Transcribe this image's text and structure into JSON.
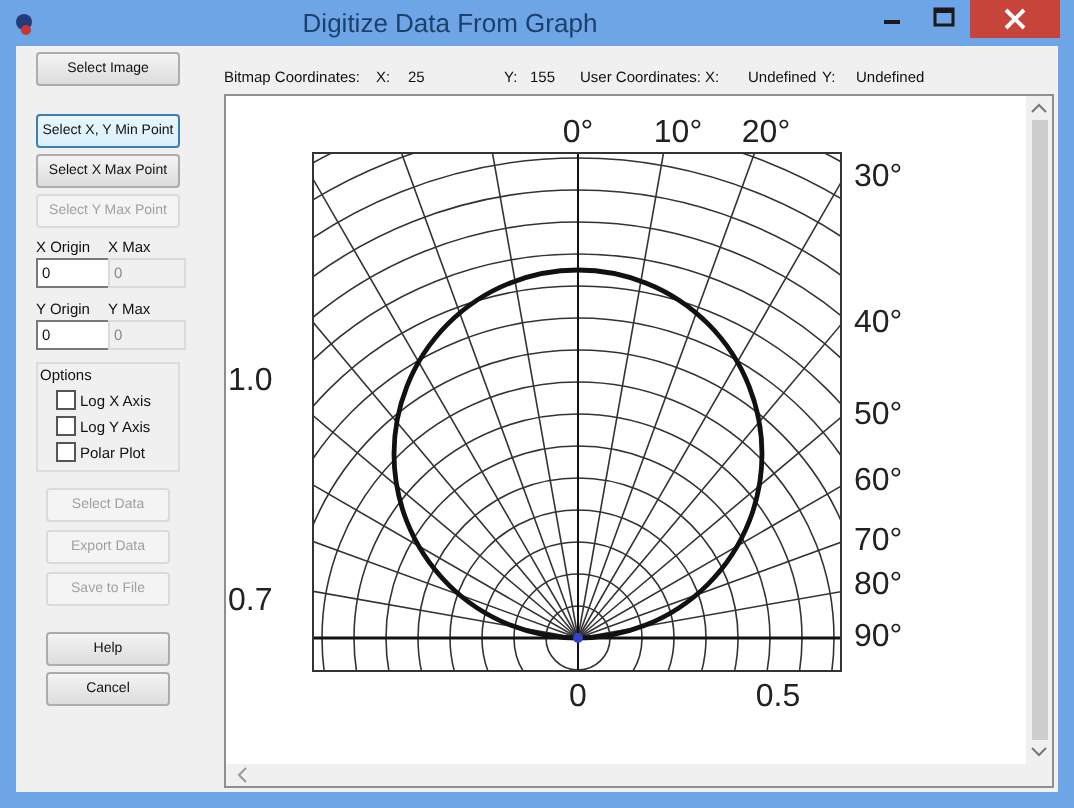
{
  "window": {
    "title": "Digitize Data From Graph"
  },
  "top_buttons": [
    {
      "label": "Select Image",
      "disabled": false,
      "focused": false
    },
    {
      "label": "Select X, Y Min Point",
      "disabled": false,
      "focused": true
    },
    {
      "label": "Select X Max Point",
      "disabled": false,
      "focused": false
    },
    {
      "label": "Select Y Max Point",
      "disabled": true,
      "focused": false
    }
  ],
  "fields": [
    {
      "label": "X Origin",
      "value": "0",
      "disabled": false
    },
    {
      "label": "X Max",
      "value": "0",
      "disabled": true
    },
    {
      "label": "Y Origin",
      "value": "0",
      "disabled": false
    },
    {
      "label": "Y Max",
      "value": "0",
      "disabled": true
    }
  ],
  "options": {
    "title": "Options",
    "items": [
      {
        "label": "Log X Axis",
        "checked": false
      },
      {
        "label": "Log Y Axis",
        "checked": false
      },
      {
        "label": "Polar Plot",
        "checked": false
      }
    ]
  },
  "action_buttons": [
    {
      "label": "Select Data",
      "disabled": true
    },
    {
      "label": "Export Data",
      "disabled": true
    },
    {
      "label": "Save to File",
      "disabled": true
    }
  ],
  "bottom_buttons": [
    {
      "label": "Help",
      "disabled": false
    },
    {
      "label": "Cancel",
      "disabled": false
    }
  ],
  "coordinates": {
    "bitmap_label": "Bitmap Coordinates:",
    "x_label": "X:",
    "x_value": "25",
    "y_label": "Y:",
    "y_value": "155",
    "user_label": "User Coordinates: X:",
    "user_x_value": "Undefined",
    "user_y_label": "Y:",
    "user_y_value": "Undefined"
  },
  "graph_image": {
    "angle_labels": [
      "0°",
      "10°",
      "20°",
      "30°",
      "40°",
      "50°",
      "60°",
      "70°",
      "80°",
      "90°"
    ],
    "axis_labels": [
      "1.0",
      "0.7",
      "0",
      "0.5"
    ]
  }
}
